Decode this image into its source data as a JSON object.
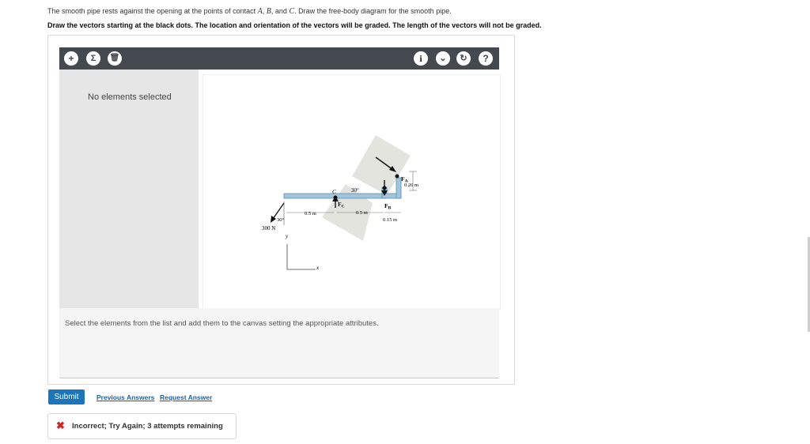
{
  "question": {
    "line1_a": "The smooth pipe rests against the opening at the points of contact ",
    "pt_a": "A",
    "sep1": ", ",
    "pt_b": "B",
    "sep2": ", and ",
    "pt_c": "C",
    "line1_b": ". Draw the free-body diagram for the smooth pipe.",
    "line2": "Draw the vectors starting at the black dots. The location and orientation of the vectors will be graded. The length of the vectors will not be graded."
  },
  "toolbar": {
    "add_symbol": "+",
    "sum_symbol": "Σ",
    "trash_symbol": "🗑",
    "info_symbol": "i",
    "chevron_symbol": "⌄",
    "reset_symbol": "↻",
    "help_symbol": "?"
  },
  "panel": {
    "no_elements": "No elements selected",
    "hint": "Select the elements from the list and add them to the canvas setting the appropriate attributes."
  },
  "figure": {
    "label_c": "C",
    "angle_top": "30°",
    "label_fc": "F",
    "sub_c": "C",
    "label_fb": "F",
    "sub_b": "B",
    "label_fa": "F",
    "sub_a": "A",
    "dim_026": "0.26 m",
    "dim_05_left": "0.5 m",
    "dim_05_right": "0.5 m",
    "dim_015": "0.15 m",
    "load": "300 N",
    "angle_load": "30°",
    "axis_y": "y",
    "axis_x": "x"
  },
  "actions": {
    "submit": "Submit",
    "previous_answers": "Previous Answers",
    "request_answer": "Request Answer"
  },
  "feedback": {
    "icon": "✖",
    "message": "Incorrect; Try Again; 3 attempts remaining"
  },
  "colors": {
    "toolbar_bg": "#44484f",
    "submit_bg": "#1b75bb",
    "error": "#c62828",
    "link": "#1b5ea8"
  }
}
